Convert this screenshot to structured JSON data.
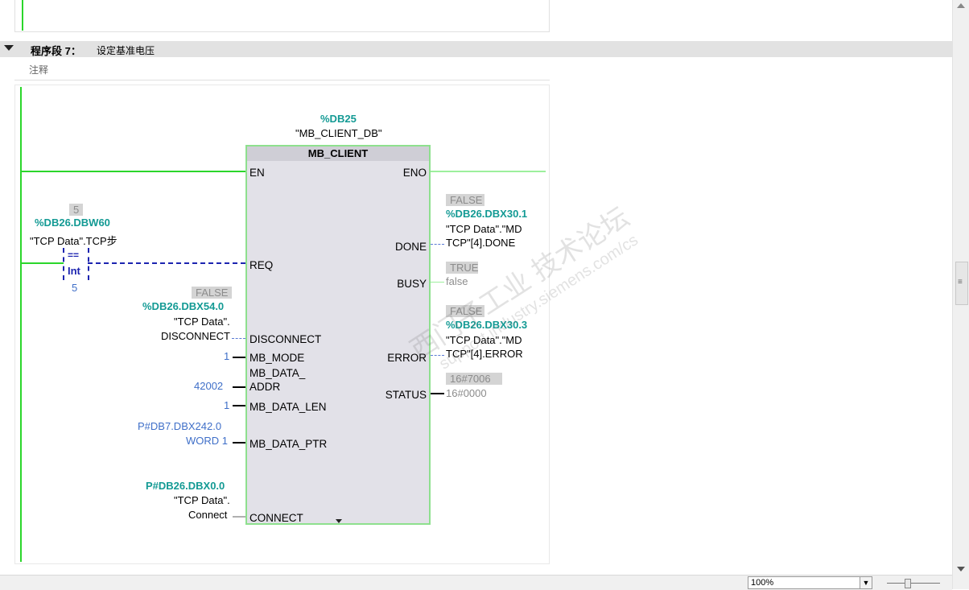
{
  "network": {
    "label": "程序段 7：",
    "title": "设定基准电压",
    "comment_label": "注释"
  },
  "instance": {
    "address": "%DB25",
    "name": "\"MB_CLIENT_DB\""
  },
  "block": {
    "name": "MB_CLIENT",
    "inputs": {
      "en": "EN",
      "req": "REQ",
      "disconnect": "DISCONNECT",
      "mb_mode": "MB_MODE",
      "mb_data_addr_1": "MB_DATA_",
      "mb_data_addr_2": "ADDR",
      "mb_data_len": "MB_DATA_LEN",
      "mb_data_ptr": "MB_DATA_PTR",
      "connect": "CONNECT"
    },
    "outputs": {
      "eno": "ENO",
      "done": "DONE",
      "busy": "BUSY",
      "error": "ERROR",
      "status": "STATUS"
    }
  },
  "compare": {
    "operator": "==",
    "type": "Int",
    "operand_value": "5",
    "operand_address": "%DB26.DBW60",
    "operand_name": "\"TCP Data\".TCP步",
    "constant": "5"
  },
  "params": {
    "disconnect_value": "FALSE",
    "disconnect_address": "%DB26.DBX54.0",
    "disconnect_name_1": "\"TCP Data\".",
    "disconnect_name_2": "DISCONNECT",
    "mb_mode": "1",
    "mb_data_addr": "42002",
    "mb_data_len": "1",
    "mb_data_ptr_1": "P#DB7.DBX242.0",
    "mb_data_ptr_2": "WORD 1",
    "connect_address": "P#DB26.DBX0.0",
    "connect_name_1": "\"TCP Data\".",
    "connect_name_2": "Connect",
    "done_value": "FALSE",
    "done_address": "%DB26.DBX30.1",
    "done_name_1": "\"TCP Data\".\"MD",
    "done_name_2": "TCP\"[4].DONE",
    "busy_value": "TRUE",
    "busy_name": "false",
    "error_value": "FALSE",
    "error_address": "%DB26.DBX30.3",
    "error_name_1": "\"TCP Data\".\"MD",
    "error_name_2": "TCP\"[4].ERROR",
    "status_value": "16#7006",
    "status_name": "16#0000"
  },
  "statusbar": {
    "zoom": "100%"
  },
  "watermark": {
    "line1": "西门子工业  技术论坛",
    "line2": "support.industry.siemens.com/cs"
  }
}
